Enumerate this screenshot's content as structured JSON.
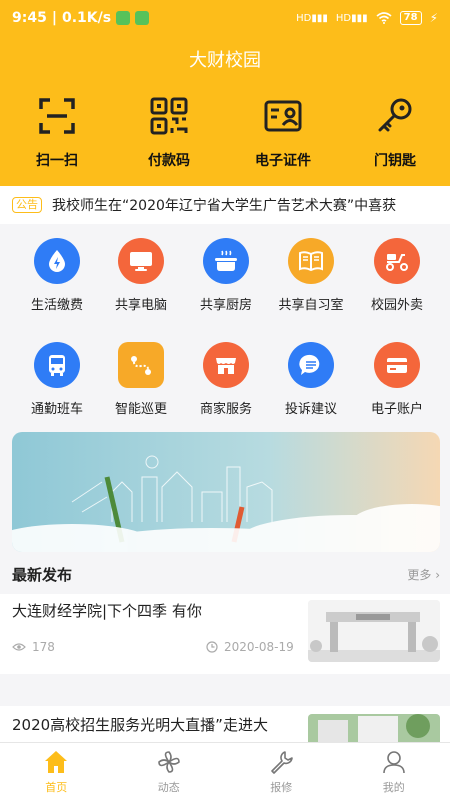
{
  "status_bar": {
    "time": "9:45",
    "speed": "0.1K/s",
    "signal1": "HD",
    "signal2": "HD",
    "battery": "78"
  },
  "app": {
    "title": "大财校园"
  },
  "quick_actions": [
    {
      "label": "扫一扫",
      "icon": "scan-icon"
    },
    {
      "label": "付款码",
      "icon": "qrcode-icon"
    },
    {
      "label": "电子证件",
      "icon": "id-card-icon"
    },
    {
      "label": "门钥匙",
      "icon": "key-icon"
    }
  ],
  "notice": {
    "badge": "公告",
    "text": "我校师生在“2020年辽宁省大学生广告艺术大赛”中喜获"
  },
  "services": [
    {
      "label": "生活缴费",
      "icon": "water-drop-icon",
      "color": "#2f7cf6"
    },
    {
      "label": "共享电脑",
      "icon": "monitor-icon",
      "color": "#f4663b"
    },
    {
      "label": "共享厨房",
      "icon": "pot-icon",
      "color": "#2f7cf6"
    },
    {
      "label": "共享自习室",
      "icon": "book-icon",
      "color": "#f7a928"
    },
    {
      "label": "校园外卖",
      "icon": "scooter-icon",
      "color": "#f4663b"
    },
    {
      "label": "通勤班车",
      "icon": "bus-icon",
      "color": "#2f7cf6"
    },
    {
      "label": "智能巡更",
      "icon": "route-icon",
      "color": "#f7a928"
    },
    {
      "label": "商家服务",
      "icon": "store-icon",
      "color": "#f4663b"
    },
    {
      "label": "投诉建议",
      "icon": "chat-icon",
      "color": "#2f7cf6"
    },
    {
      "label": "电子账户",
      "icon": "wallet-icon",
      "color": "#f4663b"
    }
  ],
  "news": {
    "section_title": "最新发布",
    "more_label": "更多",
    "items": [
      {
        "title": "大连财经学院|下个四季 有你",
        "views": "178",
        "date": "2020-08-19"
      },
      {
        "title": "2020高校招生服务光明大直播”走进大"
      }
    ]
  },
  "tabs": [
    {
      "label": "首页",
      "icon": "home-icon",
      "active": true
    },
    {
      "label": "动态",
      "icon": "pinwheel-icon",
      "active": false
    },
    {
      "label": "报修",
      "icon": "wrench-icon",
      "active": false
    },
    {
      "label": "我的",
      "icon": "user-icon",
      "active": false
    }
  ]
}
